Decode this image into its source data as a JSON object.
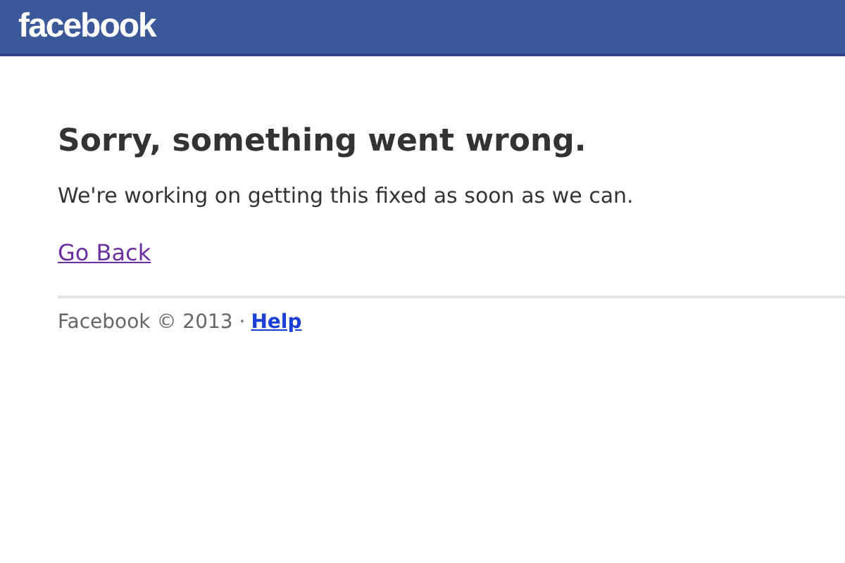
{
  "header": {
    "logo": "facebook"
  },
  "error": {
    "title": "Sorry, something went wrong.",
    "message": "We're working on getting this fixed as soon as we can.",
    "link": "Go Back"
  },
  "footer": {
    "copyright": "Facebook © 2013 ·",
    "link": "Help"
  }
}
